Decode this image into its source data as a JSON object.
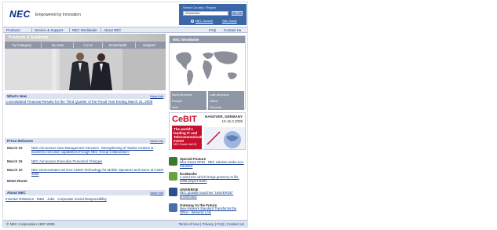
{
  "brand": {
    "logo": "NEC",
    "tagline": "Empowered by Innovation"
  },
  "util": {
    "top_link": "Select Country / Region",
    "country_value": "Worldwide",
    "go_label": "Go",
    "search_label": "NEC Search",
    "site_guide_label": "Site Guide"
  },
  "nav": {
    "items": [
      "Products",
      "Service & Support",
      "NEC Worldwide",
      "About NEC"
    ],
    "faq": "FAQ",
    "contact": "Contact Us"
  },
  "hero": {
    "title": "Products & Solutions",
    "tabs": [
      "by Category",
      "by User",
      "A to Z",
      "Downloads",
      "Support"
    ]
  },
  "worldwide": {
    "title": "NEC Worldwide",
    "regions": [
      "North America",
      "Latin America",
      "Europe",
      "Africa",
      "Asia",
      "Oceania"
    ]
  },
  "whats_new": {
    "title": "What's New",
    "more": "More info",
    "item": "Consolidated Financial Results for the Third Quarter of the Fiscal Year Ending March 31, 2005"
  },
  "press": {
    "title": "Press Releases",
    "more": "More info",
    "items": [
      {
        "date": "March 15",
        "text": "NEC Announces New Management Structure -Strengthening of market creation & business execution capabilities through NEC Group collaboration-"
      },
      {
        "date": "March 15",
        "text": "NEC Announces Executive Personnel Changes"
      },
      {
        "date": "March 10",
        "text": "NEC Demonstrates 60 GHz CDMA Technology for Mobile Operators and Users at CeBIT 2005"
      }
    ],
    "newsroom": "News Room"
  },
  "about": {
    "title": "About NEC",
    "more": "More info",
    "links": "Investor Relations   R&D   Jobs   Corporate Social Responsibility"
  },
  "cebit": {
    "logo": "CeBIT",
    "city": "HANOVER, GERMANY",
    "dates": "10-16.3.2005",
    "headline": "The world's leading IT and Telecommunications event!",
    "sub": "NEC Booth Hall 26"
  },
  "features": [
    {
      "title": "Special Feature",
      "text": "New Green RFID - NEC solution seeks eco-solutions",
      "color": "#3a7a2a"
    },
    {
      "title": "EcoBooks",
      "text": "A word tree which brings greenery to life, 2005 project starts",
      "color": "#6aa33b"
    },
    {
      "title": "UNIVERGE",
      "text": "NEC globally launches \"UNIVERGE\" architecture",
      "color": "#2b4f8a"
    },
    {
      "title": "Gateway to the Future",
      "text": "New Network Standard Transforms the Office - Wireless LAN",
      "color": "#4a6fa8"
    }
  ],
  "footer": {
    "copyright": "© NEC Corporation 1997-2005",
    "links": "Terms of Use | Privacy | FAQ | Contact Us"
  },
  "colors": {
    "brand_blue": "#0b2c8a",
    "link_blue": "#123d8f",
    "header_blue": "#3b67a8",
    "cebit_red": "#c8102e"
  }
}
